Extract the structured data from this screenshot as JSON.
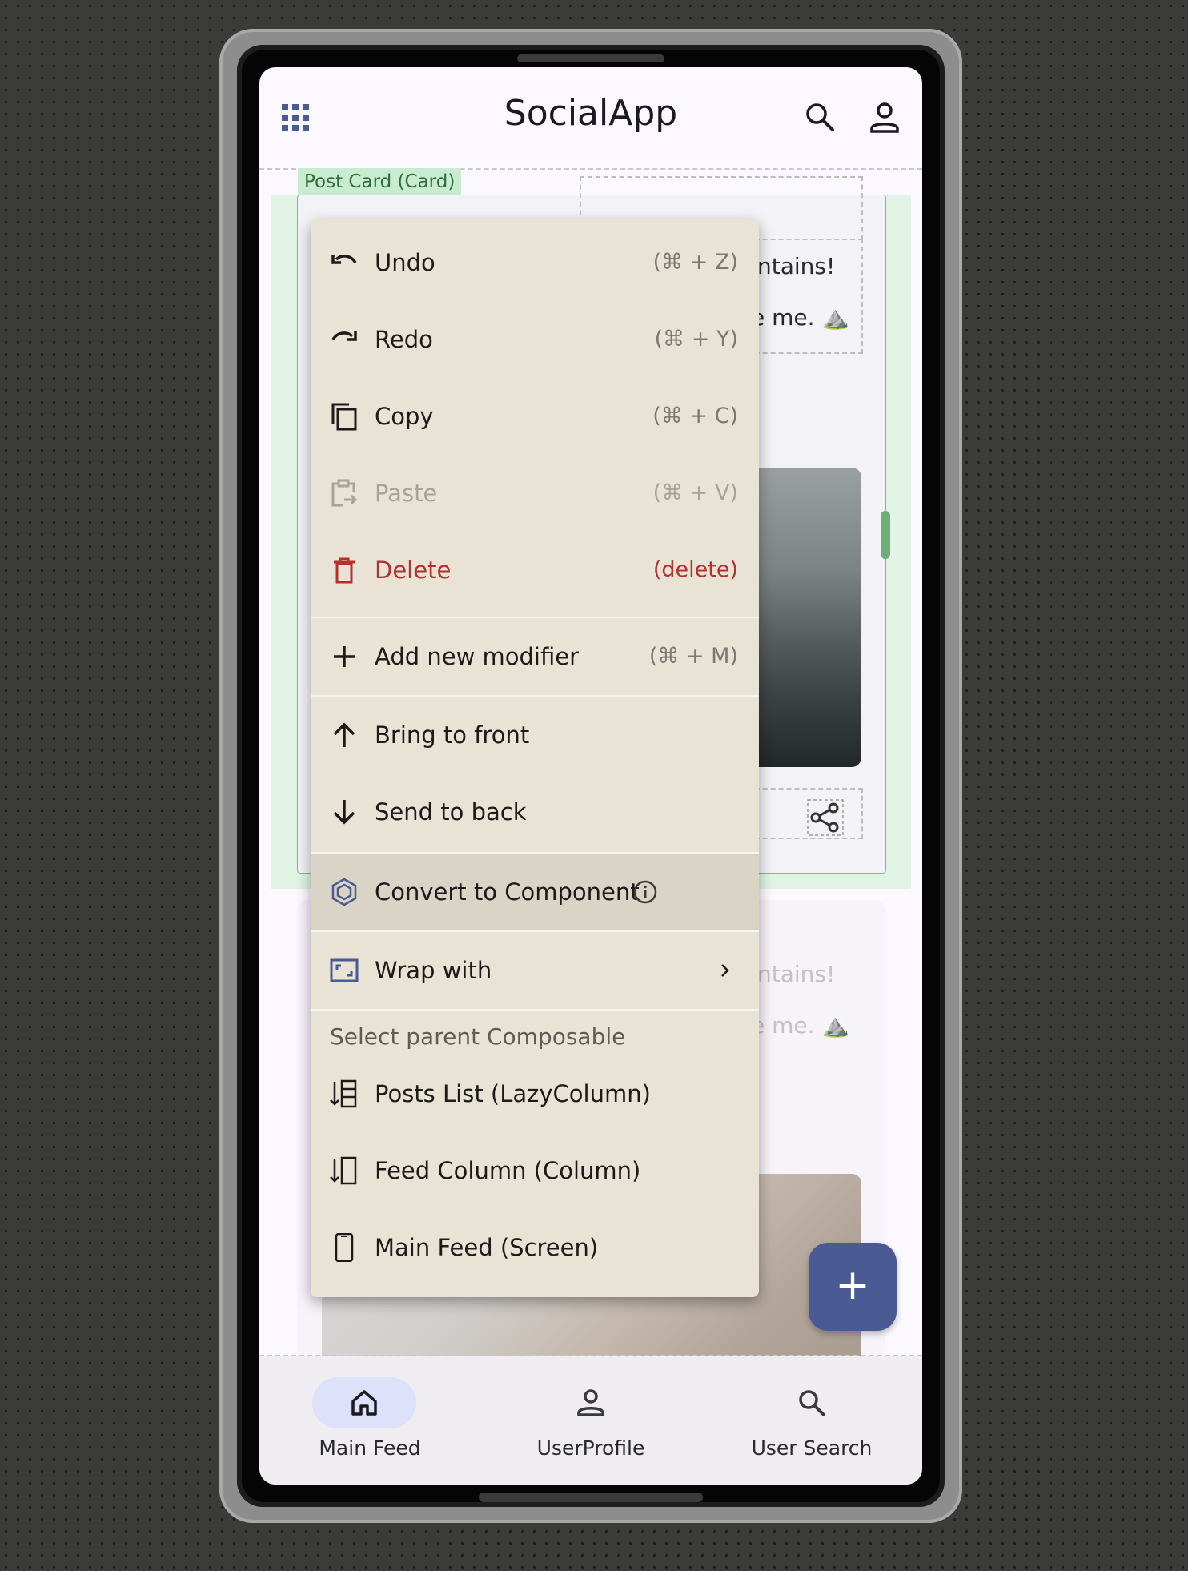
{
  "app": {
    "title": "SocialApp"
  },
  "selection": {
    "label": "Post Card (Card)"
  },
  "post_cards": [
    {
      "line1_fragment": "ntains!",
      "line2_fragment": "e me. ⛰️"
    },
    {
      "line1_fragment": "ntains!",
      "line2_fragment": "e me. ⛰️"
    }
  ],
  "context_menu": {
    "items": [
      {
        "label": "Undo",
        "shortcut": "(⌘ + Z)",
        "icon": "undo-icon"
      },
      {
        "label": "Redo",
        "shortcut": "(⌘ + Y)",
        "icon": "redo-icon"
      },
      {
        "label": "Copy",
        "shortcut": "(⌘ + C)",
        "icon": "copy-icon"
      },
      {
        "label": "Paste",
        "shortcut": "(⌘ + V)",
        "icon": "paste-icon",
        "disabled": true
      },
      {
        "label": "Delete",
        "shortcut": "(delete)",
        "icon": "trash-icon",
        "color": "#b3312c"
      },
      {
        "label": "Add new modifier",
        "shortcut": "(⌘ + M)",
        "icon": "plus-icon"
      },
      {
        "label": "Bring to front",
        "icon": "arrow-up-icon"
      },
      {
        "label": "Send to back",
        "icon": "arrow-down-icon"
      },
      {
        "label": "Convert to Component",
        "icon": "component-icon",
        "info_icon": "info-icon"
      },
      {
        "label": "Wrap with",
        "icon": "wrap-icon",
        "submenu_icon": "chevron-right-icon"
      }
    ],
    "parent_section_title": "Select parent Composable",
    "parents": [
      {
        "label": "Posts List (LazyColumn)",
        "icon": "lazycolumn-icon"
      },
      {
        "label": "Feed Column (Column)",
        "icon": "column-icon"
      },
      {
        "label": "Main Feed (Screen)",
        "icon": "phone-icon"
      }
    ]
  },
  "fab": {
    "icon": "plus-icon"
  },
  "bottom_nav": [
    {
      "label": "Main Feed",
      "icon": "home-icon",
      "selected": true
    },
    {
      "label": "UserProfile",
      "icon": "person-icon",
      "selected": false
    },
    {
      "label": "User Search",
      "icon": "search-icon",
      "selected": false
    }
  ],
  "colors": {
    "accent": "#4a5a94",
    "selection": "#7bbd87",
    "menu_bg": "#e8e3d5",
    "danger": "#b3312c"
  }
}
